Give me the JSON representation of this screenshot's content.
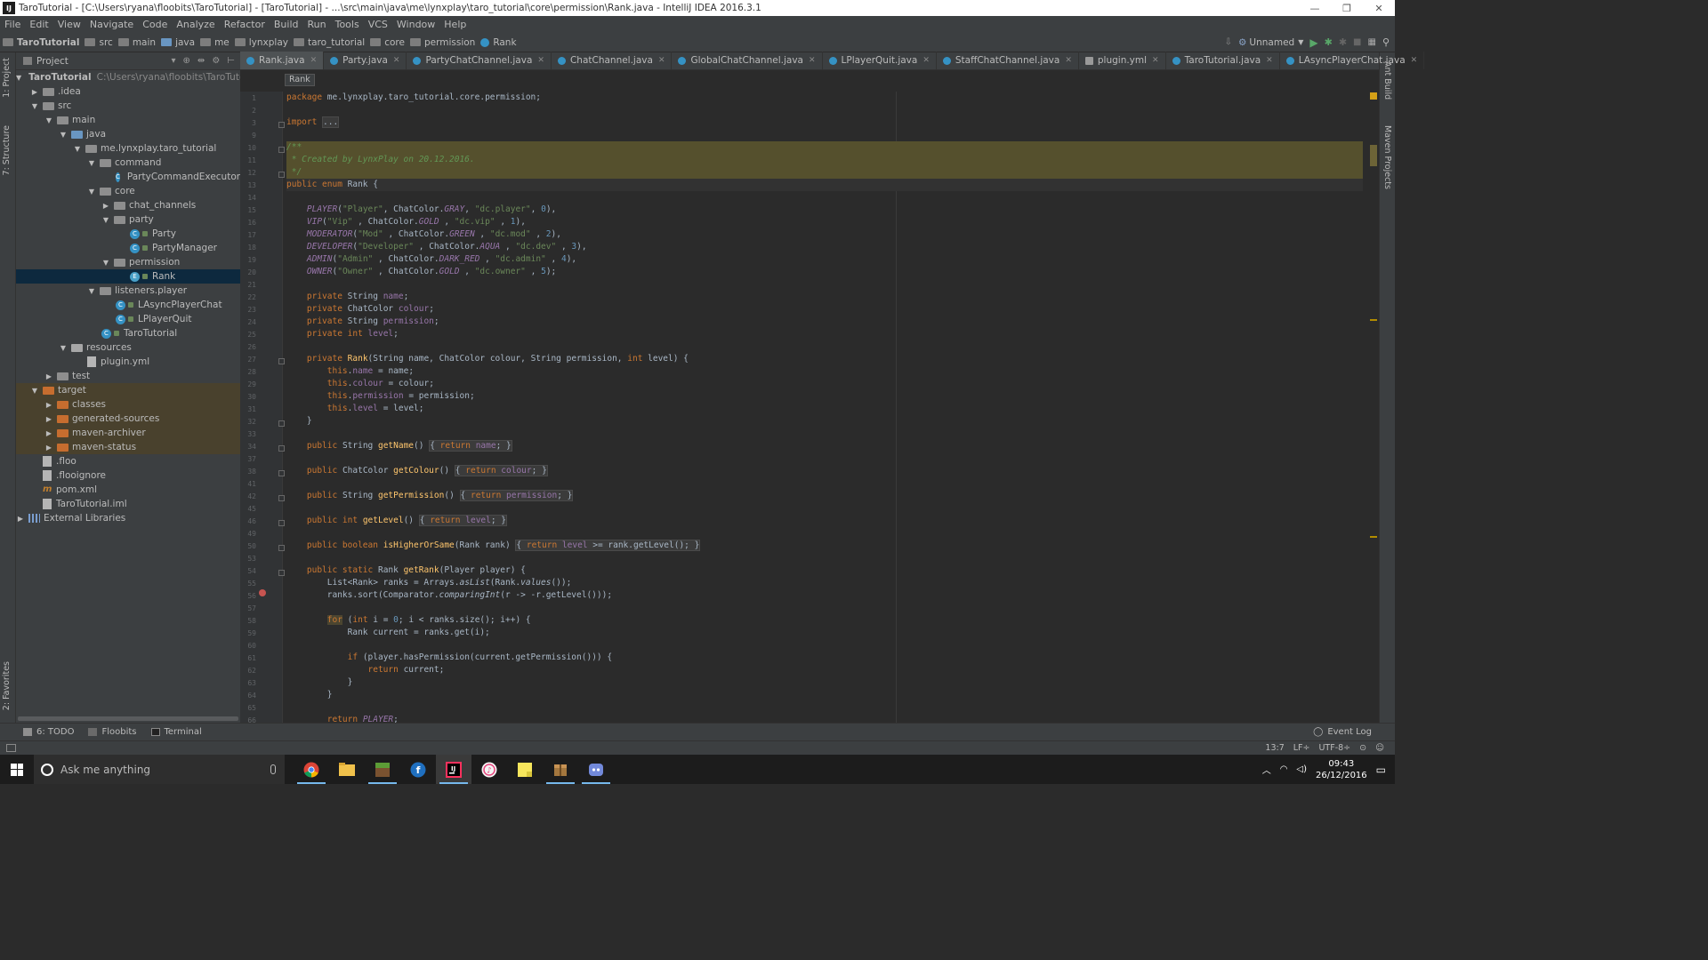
{
  "window": {
    "title": "TaroTutorial - [C:\\Users\\ryana\\floobits\\TaroTutorial] - [TaroTutorial] - ...\\src\\main\\java\\me\\lynxplay\\taro_tutorial\\core\\permission\\Rank.java - IntelliJ IDEA 2016.3.1"
  },
  "menu": [
    "File",
    "Edit",
    "View",
    "Navigate",
    "Code",
    "Analyze",
    "Refactor",
    "Build",
    "Run",
    "Tools",
    "VCS",
    "Window",
    "Help"
  ],
  "breadcrumb": [
    "TaroTutorial",
    "src",
    "main",
    "java",
    "me",
    "lynxplay",
    "taro_tutorial",
    "core",
    "permission",
    "Rank"
  ],
  "run_config": "Unnamed",
  "project_panel": {
    "title": "Project"
  },
  "tree": [
    {
      "label": "TaroTutorial",
      "path": "C:\\Users\\ryana\\floobits\\TaroTutorial",
      "bold": true
    },
    {
      "label": ".idea"
    },
    {
      "label": "src"
    },
    {
      "label": "main"
    },
    {
      "label": "java"
    },
    {
      "label": "me.lynxplay.taro_tutorial"
    },
    {
      "label": "command"
    },
    {
      "label": "PartyCommandExecutor"
    },
    {
      "label": "core"
    },
    {
      "label": "chat_channels"
    },
    {
      "label": "party"
    },
    {
      "label": "Party"
    },
    {
      "label": "PartyManager"
    },
    {
      "label": "permission"
    },
    {
      "label": "Rank"
    },
    {
      "label": "listeners.player"
    },
    {
      "label": "LAsyncPlayerChat"
    },
    {
      "label": "LPlayerQuit"
    },
    {
      "label": "TaroTutorial"
    },
    {
      "label": "resources"
    },
    {
      "label": "plugin.yml"
    },
    {
      "label": "test"
    },
    {
      "label": "target"
    },
    {
      "label": "classes"
    },
    {
      "label": "generated-sources"
    },
    {
      "label": "maven-archiver"
    },
    {
      "label": "maven-status"
    },
    {
      "label": ".floo"
    },
    {
      "label": ".flooignore"
    },
    {
      "label": "pom.xml"
    },
    {
      "label": "TaroTutorial.iml"
    },
    {
      "label": "External Libraries"
    }
  ],
  "tabs": [
    "Rank.java",
    "Party.java",
    "PartyChatChannel.java",
    "ChatChannel.java",
    "GlobalChatChannel.java",
    "LPlayerQuit.java",
    "StaffChatChannel.java",
    "plugin.yml",
    "TaroTutorial.java",
    "LAsyncPlayerChat.java"
  ],
  "editor_breadcrumb": "Rank",
  "line_numbers": [
    "1",
    "2",
    "3",
    "9",
    "10",
    "11",
    "12",
    "13",
    "14",
    "15",
    "16",
    "17",
    "18",
    "19",
    "20",
    "21",
    "22",
    "23",
    "24",
    "25",
    "26",
    "27",
    "28",
    "29",
    "30",
    "31",
    "32",
    "33",
    "34",
    "37",
    "38",
    "41",
    "42",
    "45",
    "46",
    "49",
    "50",
    "53",
    "54",
    "55",
    "56",
    "57",
    "58",
    "59",
    "60",
    "61",
    "62",
    "63",
    "64",
    "65",
    "66"
  ],
  "side_tools": {
    "project": "1: Project",
    "structure": "7: Structure",
    "favorites": "2: Favorites",
    "ant": "Ant Build",
    "maven": "Maven Projects"
  },
  "bottom_tools": [
    "6: TODO",
    "Floobits",
    "Terminal"
  ],
  "event_log": "Event Log",
  "status": {
    "position": "13:7",
    "line_sep": "LF÷",
    "encoding": "UTF-8÷"
  },
  "taskbar": {
    "search_placeholder": "Ask me anything",
    "time": "09:43",
    "date": "26/12/2016"
  },
  "colors": {
    "accent": "#3592c4",
    "keyword": "#cc7832",
    "string": "#6a8759",
    "number": "#6897bb",
    "field": "#9876aa",
    "method": "#ffc66d"
  }
}
